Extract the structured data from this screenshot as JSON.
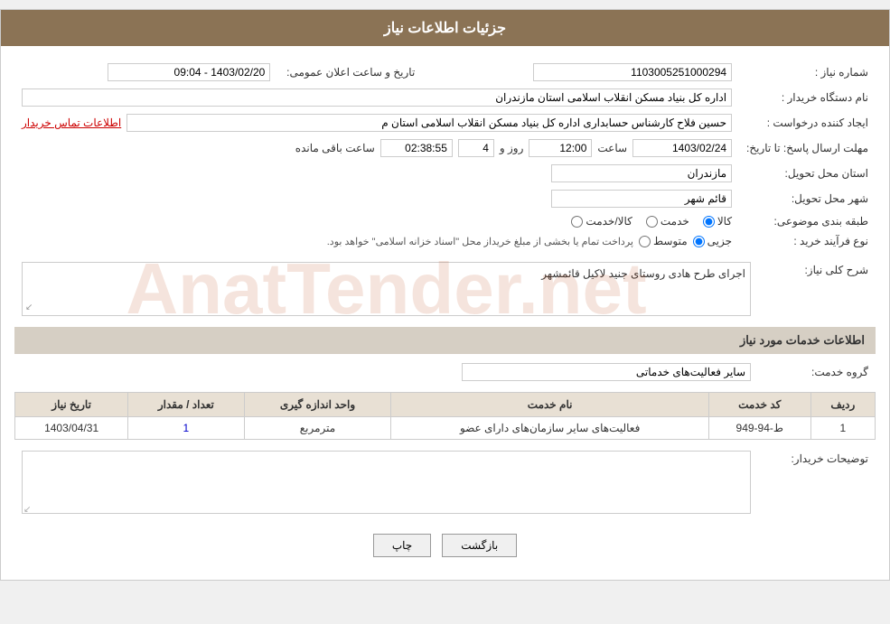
{
  "header": {
    "title": "جزئیات اطلاعات نیاز"
  },
  "fields": {
    "shomareNiaz_label": "شماره نیاز :",
    "shomareNiaz_value": "1103005251000294",
    "namDastgah_label": "نام دستگاه خریدار :",
    "namDastgah_value": "اداره کل بنیاد مسکن انقلاب اسلامی استان مازندران",
    "ijadKonande_label": "ایجاد کننده درخواست :",
    "ijadKonande_value": "حسین فلاح کارشناس حسابداری اداره کل بنیاد مسکن انقلاب اسلامی استان م",
    "ijadKonande_link": "اطلاعات تماس خریدار",
    "mohlatErsalPasokh_label": "مهلت ارسال پاسخ: تا تاریخ:",
    "tarikh_value": "1403/02/24",
    "saat_label": "ساعت",
    "saat_value": "12:00",
    "roz_label": "روز و",
    "roz_value": "4",
    "baghiMande_label": "ساعت باقی مانده",
    "baghiMande_value": "02:38:55",
    "tarikh_saatElan_label": "تاریخ و ساعت اعلان عمومی:",
    "tarikh_saatElan_value": "1403/02/20 - 09:04",
    "ostan_label": "استان محل تحویل:",
    "ostan_value": "مازندران",
    "shahr_label": "شهر محل تحویل:",
    "shahr_value": "قائم شهر",
    "tabaqeBandi_label": "طبقه بندی موضوعی:",
    "tabaqeBandi_kala": "کالا",
    "tabaqeBandi_khadamat": "خدمت",
    "tabaqeBandi_kalaKhadamat": "کالا/خدمت",
    "noeFarayand_label": "نوع فرآیند خرید :",
    "noeFarayand_jozii": "جزیی",
    "noeFarayand_motavaset": "متوسط",
    "noeFarayand_note": "پرداخت تمام یا بخشی از مبلغ خریداز محل \"اسناد خزانه اسلامی\" خواهد بود.",
    "sharhKolli_label": "شرح کلی نیاز:",
    "sharhKolli_value": "اجرای طرح هادی روستای جنید لاکیل قائمشهر",
    "etelaat_section_title": "اطلاعات خدمات مورد نیاز",
    "groheKhadamat_label": "گروه خدمت:",
    "groheKhadamat_value": "سایر فعالیت‌های خدماتی",
    "table": {
      "headers": [
        "ردیف",
        "کد خدمت",
        "نام خدمت",
        "واحد اندازه گیری",
        "تعداد / مقدار",
        "تاریخ نیاز"
      ],
      "rows": [
        {
          "radif": "1",
          "kodKhadamat": "ط-94-949",
          "namKhadamat": "فعالیت‌های سایر سازمان‌های دارای عضو",
          "vahed": "مترمربع",
          "tedad": "1",
          "tarikh": "1403/04/31"
        }
      ]
    },
    "tosifat_label": "توضیحات خریدار:",
    "tosifat_value": ""
  },
  "buttons": {
    "print_label": "چاپ",
    "back_label": "بازگشت"
  }
}
